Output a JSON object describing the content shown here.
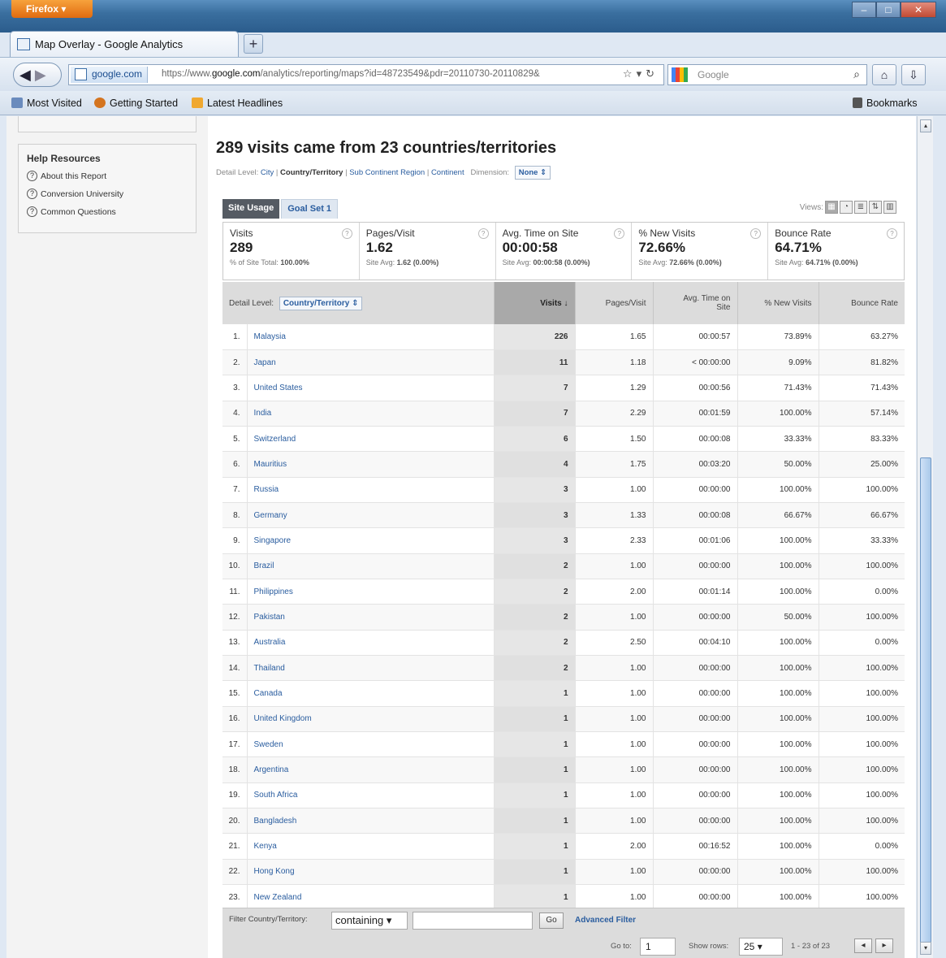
{
  "browser": {
    "app_button": "Firefox",
    "tab_title": "Map Overlay - Google Analytics",
    "new_tab": "+",
    "url_site": "google.com",
    "url_prefix": "https://www.",
    "url_domain": "google.com",
    "url_rest": "/analytics/reporting/maps?id=48723549&pdr=20110730-20110829&",
    "search_placeholder": "Google",
    "bookmarks": [
      "Most Visited",
      "Getting Started",
      "Latest Headlines"
    ],
    "bookmarks_button": "Bookmarks"
  },
  "sidebar": {
    "help_title": "Help Resources",
    "help_links": [
      "About this Report",
      "Conversion University",
      "Common Questions"
    ]
  },
  "report": {
    "title": "289 visits came from 23 countries/territories",
    "detail_level_label": "Detail Level:",
    "detail_levels": [
      "City",
      "Country/Territory",
      "Sub Continent Region",
      "Continent"
    ],
    "dimension_label": "Dimension:",
    "dimension_value": "None",
    "tabs": [
      "Site Usage",
      "Goal Set 1"
    ],
    "views_label": "Views:"
  },
  "summary": [
    {
      "label": "Visits",
      "value": "289",
      "sub_prefix": "% of Site Total:",
      "sub_value": "100.00%"
    },
    {
      "label": "Pages/Visit",
      "value": "1.62",
      "sub_prefix": "Site Avg:",
      "sub_value": "1.62 (0.00%)"
    },
    {
      "label": "Avg. Time on Site",
      "value": "00:00:58",
      "sub_prefix": "Site Avg:",
      "sub_value": "00:00:58 (0.00%)"
    },
    {
      "label": "% New Visits",
      "value": "72.66%",
      "sub_prefix": "Site Avg:",
      "sub_value": "72.66% (0.00%)"
    },
    {
      "label": "Bounce Rate",
      "value": "64.71%",
      "sub_prefix": "Site Avg:",
      "sub_value": "64.71% (0.00%)"
    }
  ],
  "table": {
    "detail_level_label": "Detail Level:",
    "detail_level_value": "Country/Territory",
    "headers": {
      "visits": "Visits",
      "pages_visit": "Pages/Visit",
      "time_line1": "Avg. Time on",
      "time_line2": "Site",
      "new_visits": "% New Visits",
      "bounce": "Bounce Rate"
    },
    "rows": [
      {
        "idx": "1.",
        "country": "Malaysia",
        "visits": "226",
        "pv": "1.65",
        "time": "00:00:57",
        "nv": "73.89%",
        "br": "63.27%"
      },
      {
        "idx": "2.",
        "country": "Japan",
        "visits": "11",
        "pv": "1.18",
        "time": "< 00:00:00",
        "nv": "9.09%",
        "br": "81.82%"
      },
      {
        "idx": "3.",
        "country": "United States",
        "visits": "7",
        "pv": "1.29",
        "time": "00:00:56",
        "nv": "71.43%",
        "br": "71.43%"
      },
      {
        "idx": "4.",
        "country": "India",
        "visits": "7",
        "pv": "2.29",
        "time": "00:01:59",
        "nv": "100.00%",
        "br": "57.14%"
      },
      {
        "idx": "5.",
        "country": "Switzerland",
        "visits": "6",
        "pv": "1.50",
        "time": "00:00:08",
        "nv": "33.33%",
        "br": "83.33%"
      },
      {
        "idx": "6.",
        "country": "Mauritius",
        "visits": "4",
        "pv": "1.75",
        "time": "00:03:20",
        "nv": "50.00%",
        "br": "25.00%"
      },
      {
        "idx": "7.",
        "country": "Russia",
        "visits": "3",
        "pv": "1.00",
        "time": "00:00:00",
        "nv": "100.00%",
        "br": "100.00%"
      },
      {
        "idx": "8.",
        "country": "Germany",
        "visits": "3",
        "pv": "1.33",
        "time": "00:00:08",
        "nv": "66.67%",
        "br": "66.67%"
      },
      {
        "idx": "9.",
        "country": "Singapore",
        "visits": "3",
        "pv": "2.33",
        "time": "00:01:06",
        "nv": "100.00%",
        "br": "33.33%"
      },
      {
        "idx": "10.",
        "country": "Brazil",
        "visits": "2",
        "pv": "1.00",
        "time": "00:00:00",
        "nv": "100.00%",
        "br": "100.00%"
      },
      {
        "idx": "11.",
        "country": "Philippines",
        "visits": "2",
        "pv": "2.00",
        "time": "00:01:14",
        "nv": "100.00%",
        "br": "0.00%"
      },
      {
        "idx": "12.",
        "country": "Pakistan",
        "visits": "2",
        "pv": "1.00",
        "time": "00:00:00",
        "nv": "50.00%",
        "br": "100.00%"
      },
      {
        "idx": "13.",
        "country": "Australia",
        "visits": "2",
        "pv": "2.50",
        "time": "00:04:10",
        "nv": "100.00%",
        "br": "0.00%"
      },
      {
        "idx": "14.",
        "country": "Thailand",
        "visits": "2",
        "pv": "1.00",
        "time": "00:00:00",
        "nv": "100.00%",
        "br": "100.00%"
      },
      {
        "idx": "15.",
        "country": "Canada",
        "visits": "1",
        "pv": "1.00",
        "time": "00:00:00",
        "nv": "100.00%",
        "br": "100.00%"
      },
      {
        "idx": "16.",
        "country": "United Kingdom",
        "visits": "1",
        "pv": "1.00",
        "time": "00:00:00",
        "nv": "100.00%",
        "br": "100.00%"
      },
      {
        "idx": "17.",
        "country": "Sweden",
        "visits": "1",
        "pv": "1.00",
        "time": "00:00:00",
        "nv": "100.00%",
        "br": "100.00%"
      },
      {
        "idx": "18.",
        "country": "Argentina",
        "visits": "1",
        "pv": "1.00",
        "time": "00:00:00",
        "nv": "100.00%",
        "br": "100.00%"
      },
      {
        "idx": "19.",
        "country": "South Africa",
        "visits": "1",
        "pv": "1.00",
        "time": "00:00:00",
        "nv": "100.00%",
        "br": "100.00%"
      },
      {
        "idx": "20.",
        "country": "Bangladesh",
        "visits": "1",
        "pv": "1.00",
        "time": "00:00:00",
        "nv": "100.00%",
        "br": "100.00%"
      },
      {
        "idx": "21.",
        "country": "Kenya",
        "visits": "1",
        "pv": "2.00",
        "time": "00:16:52",
        "nv": "100.00%",
        "br": "0.00%"
      },
      {
        "idx": "22.",
        "country": "Hong Kong",
        "visits": "1",
        "pv": "1.00",
        "time": "00:00:00",
        "nv": "100.00%",
        "br": "100.00%"
      },
      {
        "idx": "23.",
        "country": "New Zealand",
        "visits": "1",
        "pv": "1.00",
        "time": "00:00:00",
        "nv": "100.00%",
        "br": "100.00%"
      }
    ]
  },
  "filter": {
    "label": "Filter Country/Territory:",
    "mode": "containing",
    "go": "Go",
    "advanced": "Advanced Filter",
    "goto_label": "Go to:",
    "goto_value": "1",
    "rows_label": "Show rows:",
    "rows_value": "25",
    "range": "1 - 23 of 23"
  }
}
